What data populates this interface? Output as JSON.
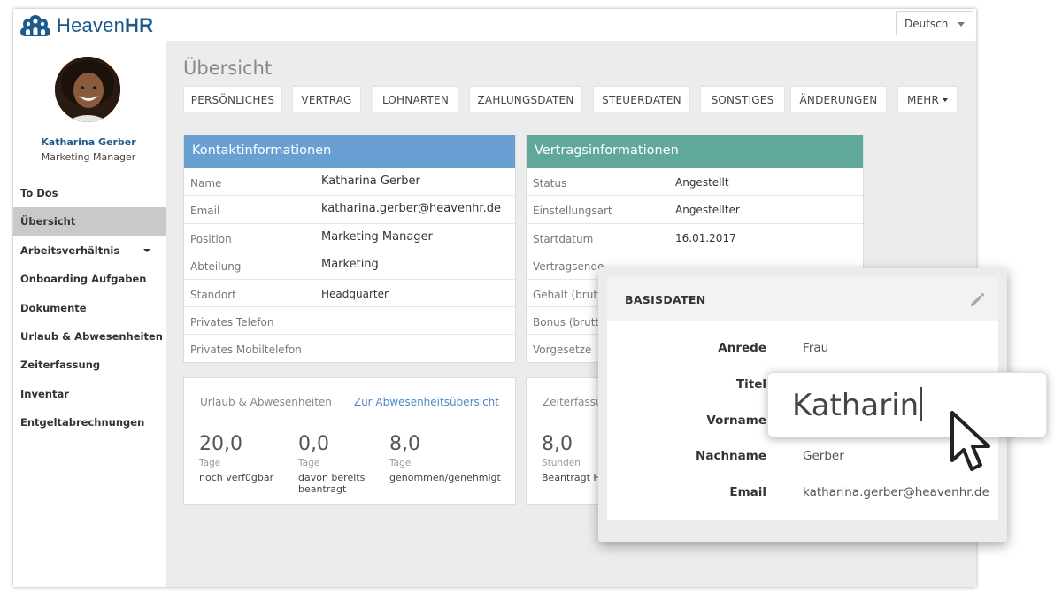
{
  "app": {
    "logo": {
      "text_light": "Heaven",
      "text_bold": "HR",
      "icon": "heavenhr-people-logo-icon"
    },
    "language": "Deutsch"
  },
  "sidebar": {
    "profile": {
      "name": "Katharina Gerber",
      "role": "Marketing Manager"
    },
    "items": [
      {
        "label": "To Dos",
        "active": false
      },
      {
        "label": "Übersicht",
        "active": true
      },
      {
        "label": "Arbeitsverhältnis",
        "active": false,
        "has_dropdown": true
      },
      {
        "label": "Onboarding Aufgaben",
        "active": false
      },
      {
        "label": "Dokumente",
        "active": false
      },
      {
        "label": "Urlaub & Abwesenheiten",
        "active": false
      },
      {
        "label": "Zeiterfassung",
        "active": false
      },
      {
        "label": "Inventar",
        "active": false
      },
      {
        "label": "Entgeltabrechnungen",
        "active": false
      }
    ]
  },
  "main": {
    "title": "Übersicht",
    "tabs": [
      {
        "label": "PERSÖNLICHES"
      },
      {
        "label": "VERTRAG"
      },
      {
        "label": "LOHNARTEN"
      },
      {
        "label": "ZAHLUNGSDATEN"
      },
      {
        "label": "STEUERDATEN"
      },
      {
        "label": "SONSTIGES"
      },
      {
        "label": "ÄNDERUNGEN"
      },
      {
        "label": "MEHR"
      }
    ],
    "contact": {
      "title": "Kontaktinformationen",
      "color": "#6a9fd4",
      "rows": [
        {
          "label": "Name",
          "value": "Katharina Gerber"
        },
        {
          "label": "Email",
          "value": "katharina.gerber@heavenhr.de"
        },
        {
          "label": "Position",
          "value": "Marketing Manager"
        },
        {
          "label": "Abteilung",
          "value": "Marketing"
        },
        {
          "label": "Standort",
          "value": "Headquarter"
        },
        {
          "label": "Privates Telefon",
          "value": ""
        },
        {
          "label": "Privates Mobiltelefon",
          "value": ""
        }
      ]
    },
    "contract": {
      "title": "Vertragsinformationen",
      "color": "#5fa89a",
      "rows": [
        {
          "label": "Status",
          "value": "Angestellt"
        },
        {
          "label": "Einstellungsart",
          "value": "Angestellter"
        },
        {
          "label": "Startdatum",
          "value": "16.01.2017"
        },
        {
          "label": "Vertragsende",
          "value": ""
        },
        {
          "label": "Gehalt (brutto",
          "value": ""
        },
        {
          "label": "Bonus (brutto",
          "value": ""
        },
        {
          "label": "Vorgesetze",
          "value": ""
        }
      ]
    },
    "absence": {
      "title": "Urlaub & Abwesenheiten",
      "link": "Zur Abwesenheitsübersicht",
      "stats": [
        {
          "num": "20,0",
          "unit": "Tage",
          "desc": "noch verfügbar"
        },
        {
          "num": "0,0",
          "unit": "Tage",
          "desc": "davon bereits beantragt"
        },
        {
          "num": "8,0",
          "unit": "Tage",
          "desc": "genommen/genehmigt"
        }
      ]
    },
    "time": {
      "title": "Zeiterfassu",
      "stat": {
        "num": "8,0",
        "unit": "Stunden",
        "desc": "Beantragt H"
      }
    }
  },
  "basisdaten": {
    "title": "BASISDATEN",
    "edit_icon": "pencil-icon",
    "rows": [
      {
        "label": "Anrede",
        "value": "Frau"
      },
      {
        "label": "Titel",
        "value": ""
      },
      {
        "label": "Vorname",
        "value": ""
      },
      {
        "label": "Nachname",
        "value": "Gerber"
      },
      {
        "label": "Email",
        "value": "katharina.gerber@heavenhr.de"
      }
    ]
  },
  "zoom_input": {
    "value": "Katharin"
  },
  "cursor_icon": "mouse-pointer-icon"
}
